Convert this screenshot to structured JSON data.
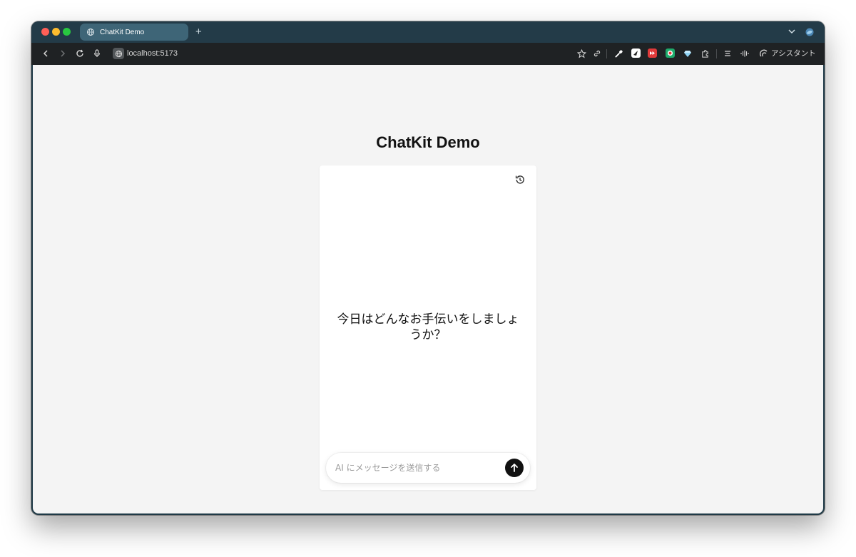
{
  "browser": {
    "tab": {
      "title": "ChatKit Demo",
      "icon": "globe-icon"
    },
    "new_tab_label": "+",
    "address": {
      "url": "localhost:5173"
    },
    "assistant_label": "アシスタント"
  },
  "page": {
    "title": "ChatKit Demo"
  },
  "chat": {
    "history_icon": "history-icon",
    "greeting": "今日はどんなお手伝いをしましょうか？",
    "composer": {
      "placeholder": "AI にメッセージを送信する",
      "value": ""
    },
    "send_icon": "arrow-up-icon"
  },
  "colors": {
    "page_background": "#f4f4f4",
    "card_background": "#ffffff",
    "send_button": "#111111",
    "tab_active": "#3e6577",
    "toolbar": "#1f2224"
  }
}
